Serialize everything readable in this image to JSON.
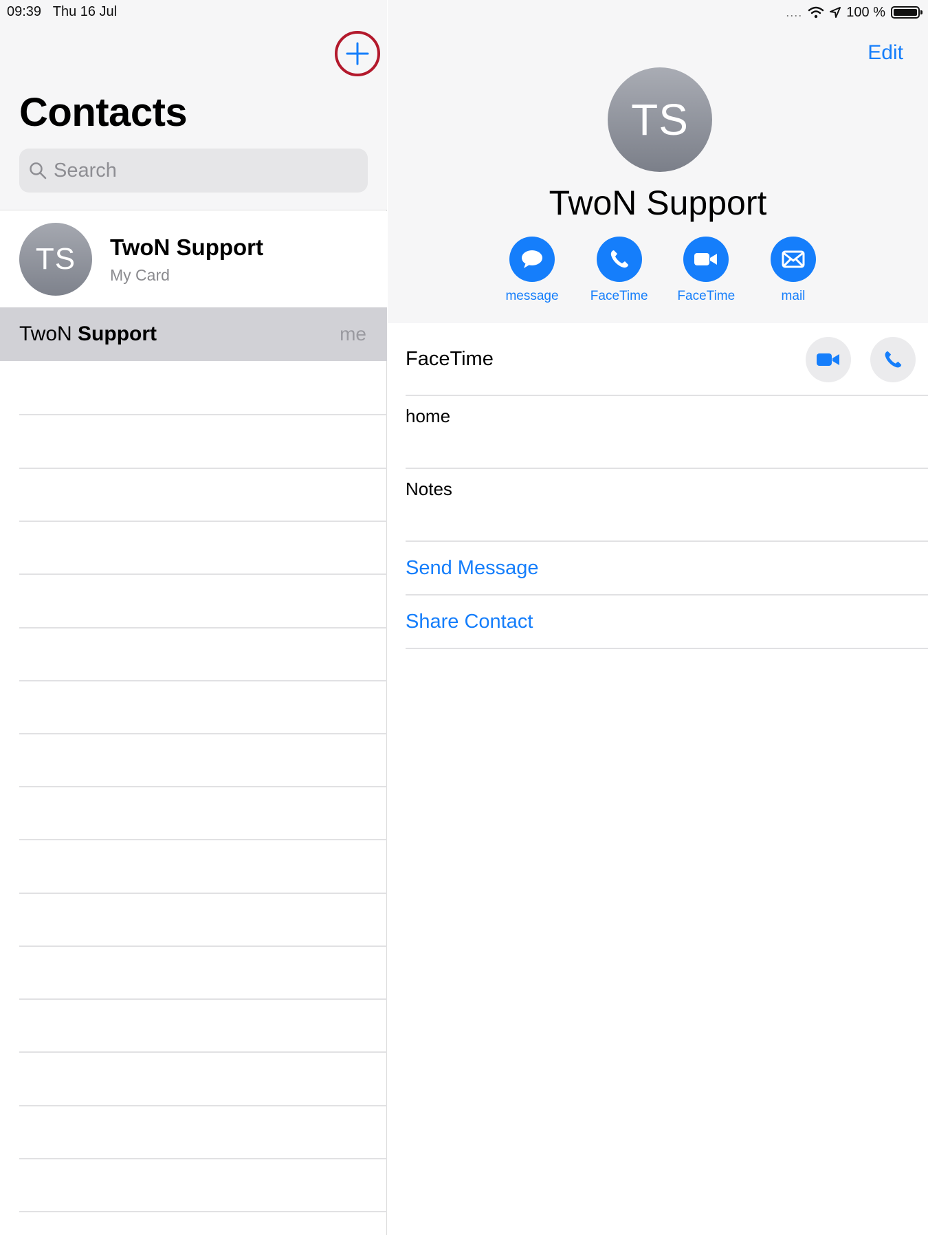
{
  "status_bar": {
    "time": "09:39",
    "date": "Thu 16 Jul",
    "signal": "....",
    "battery": "100 %",
    "icons": [
      "wifi-icon",
      "location-icon",
      "battery-icon"
    ]
  },
  "contacts_list": {
    "title": "Contacts",
    "search_placeholder": "Search",
    "my_card": {
      "initials": "TS",
      "name": "TwoN Support",
      "subtitle": "My Card"
    },
    "rows": [
      {
        "first": "TwoN",
        "last": "Support",
        "badge": "me",
        "selected": true
      }
    ]
  },
  "detail": {
    "edit_label": "Edit",
    "initials": "TS",
    "name": "TwoN Support",
    "actions": [
      {
        "label": "message",
        "icon": "message-bubble-icon"
      },
      {
        "label": "FaceTime",
        "icon": "phone-icon"
      },
      {
        "label": "FaceTime",
        "icon": "video-camera-icon"
      },
      {
        "label": "mail",
        "icon": "envelope-icon"
      }
    ],
    "facetime_label": "FaceTime",
    "home_label": "home",
    "notes_label": "Notes",
    "send_message": "Send Message",
    "share_contact": "Share Contact"
  },
  "colors": {
    "accent": "#157efb",
    "highlight_ring": "#b3192c",
    "selected_row": "#d1d1d6",
    "header_bg": "#f6f6f7"
  }
}
